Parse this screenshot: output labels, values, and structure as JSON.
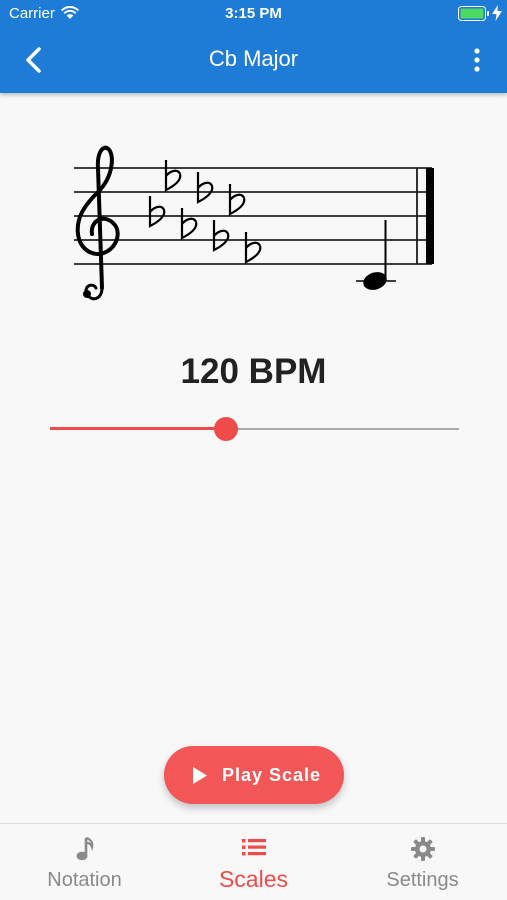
{
  "status_bar": {
    "carrier": "Carrier",
    "time": "3:15 PM"
  },
  "header": {
    "title": "Cb Major",
    "back_icon": "chevron-left-icon",
    "menu_icon": "more-vertical-icon"
  },
  "tempo": {
    "label": "120 BPM",
    "slider_fraction": 0.43
  },
  "play_button": {
    "label": "Play Scale",
    "icon": "play-icon"
  },
  "tabs": [
    {
      "label": "Notation",
      "icon": "music-note-icon",
      "active": false
    },
    {
      "label": "Scales",
      "icon": "list-icon",
      "active": true
    },
    {
      "label": "Settings",
      "icon": "gear-icon",
      "active": false
    }
  ],
  "colors": {
    "header": "#1e7cd6",
    "accent": "#f04b4b",
    "inactive": "#8a8a8a"
  }
}
